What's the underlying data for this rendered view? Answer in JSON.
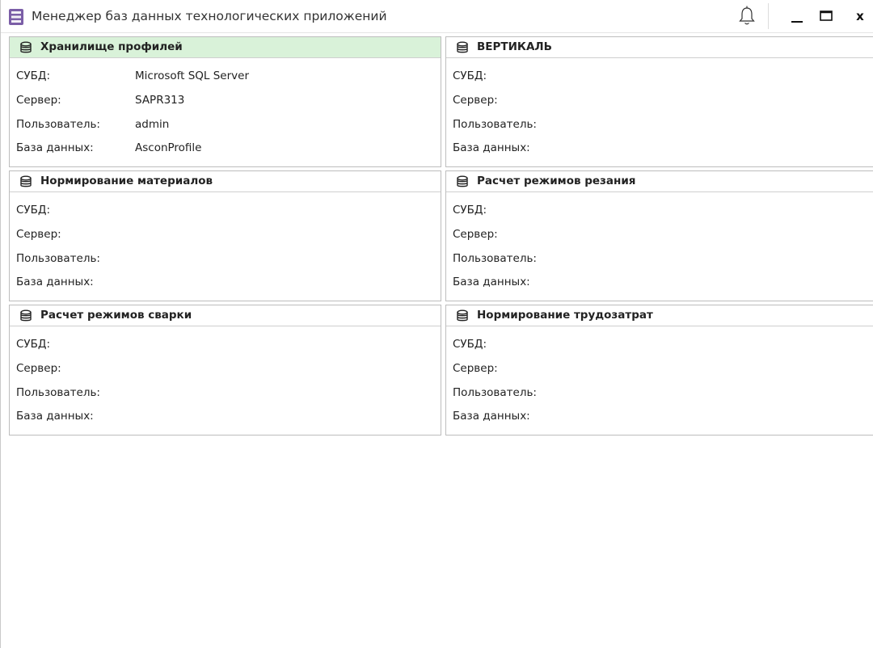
{
  "window": {
    "title": "Менеджер баз данных технологических приложений",
    "icons": {
      "app": "database-stack-icon",
      "notify": "bell-icon",
      "minimize": "minimize-icon",
      "maximize": "maximize-icon",
      "close": "close-icon"
    },
    "close_label": "x"
  },
  "accent_active": "#d9f2d9",
  "cards": [
    {
      "title": "Хранилище профилей",
      "active": true,
      "labels": [
        "СУБД:",
        "Сервер:",
        "Пользователь:",
        "База данных:"
      ],
      "values": [
        "Microsoft SQL Server",
        "SAPR313",
        "admin",
        "AsconProfile"
      ]
    },
    {
      "title": "ВЕРТИКАЛЬ",
      "active": false,
      "labels": [
        "СУБД:",
        "Сервер:",
        "Пользователь:",
        "База данных:"
      ],
      "values": [
        "",
        "",
        "",
        ""
      ]
    },
    {
      "title": "Нормирование материалов",
      "active": false,
      "labels": [
        "СУБД:",
        "Сервер:",
        "Пользователь:",
        "База данных:"
      ],
      "values": [
        "",
        "",
        "",
        ""
      ]
    },
    {
      "title": "Расчет режимов резания",
      "active": false,
      "labels": [
        "СУБД:",
        "Сервер:",
        "Пользователь:",
        "База данных:"
      ],
      "values": [
        "",
        "",
        "",
        ""
      ]
    },
    {
      "title": "Расчет режимов сварки",
      "active": false,
      "labels": [
        "СУБД:",
        "Сервер:",
        "Пользователь:",
        "База данных:"
      ],
      "values": [
        "",
        "",
        "",
        ""
      ]
    },
    {
      "title": "Нормирование трудозатрат",
      "active": false,
      "labels": [
        "СУБД:",
        "Сервер:",
        "Пользователь:",
        "База данных:"
      ],
      "values": [
        "",
        "",
        "",
        ""
      ]
    }
  ]
}
